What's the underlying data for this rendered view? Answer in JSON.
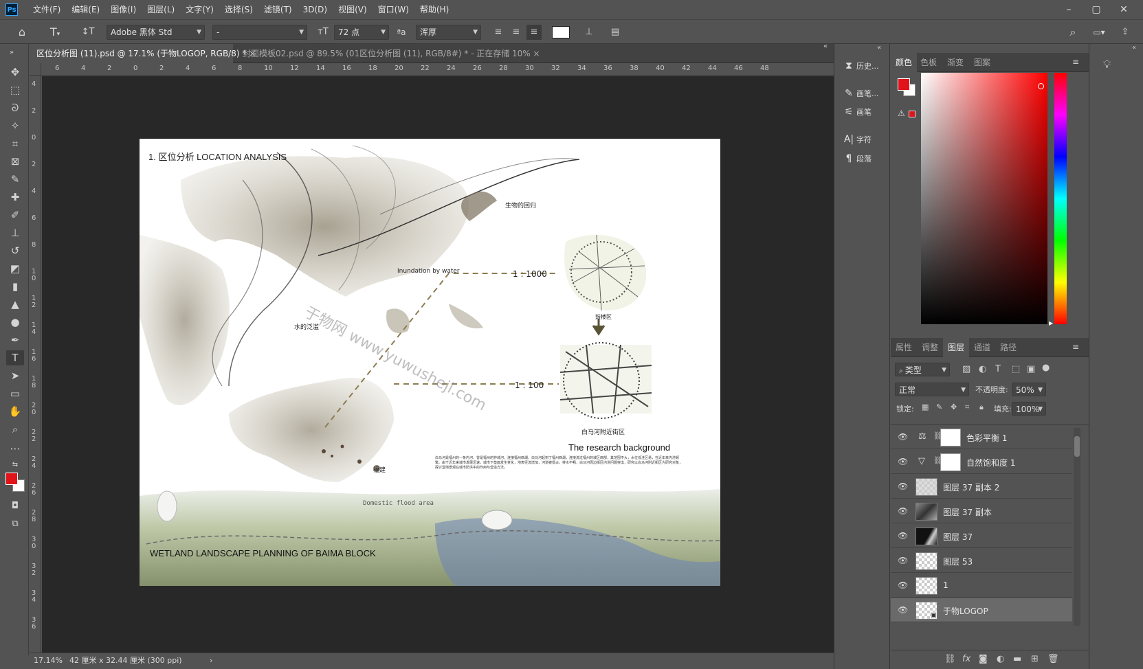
{
  "menubar": {
    "logo": "Ps",
    "items": [
      "文件(F)",
      "编辑(E)",
      "图像(I)",
      "图层(L)",
      "文字(Y)",
      "选择(S)",
      "滤镜(T)",
      "3D(D)",
      "视图(V)",
      "窗口(W)",
      "帮助(H)"
    ]
  },
  "options": {
    "font_family": "Adobe 黑体 Std",
    "font_style": "-",
    "font_size": "72 点",
    "aa_label": "ªa",
    "antialias": "浑厚"
  },
  "tabs": [
    {
      "label": "区位分析图 (11).psd @ 17.1% (于物LOGOP, RGB/8) *",
      "close": "×"
    },
    {
      "label": "封面模板02.psd @ 89.5% (01区位分析图 (11), RGB/8#) * - 正在存储 10%",
      "close": "×"
    }
  ],
  "ruler_top": [
    "6",
    "4",
    "2",
    "0",
    "2",
    "4",
    "6",
    "8",
    "10",
    "12",
    "14",
    "16",
    "18",
    "20",
    "22",
    "24",
    "26",
    "28",
    "30",
    "32",
    "34",
    "36",
    "38",
    "40",
    "42",
    "44",
    "46",
    "48"
  ],
  "ruler_left": [
    "4",
    "2",
    "0",
    "2",
    "4",
    "6",
    "8",
    "1 0",
    "1 2",
    "1 4",
    "1 6",
    "1 8",
    "2 0",
    "2 2",
    "2 4",
    "2 6",
    "2 8",
    "3 0",
    "3 2",
    "3 4",
    "3 6"
  ],
  "artwork": {
    "title": "1. 区位分析  LOCATION ANALYSIS",
    "return_label": "生物的回归",
    "inundation": "Inundation by water",
    "water_spread": "水的泛滥",
    "scale_1000": "1 : 1000",
    "scale_100": "1 : 100",
    "district": "鼓楼区",
    "street": "白马河附近街区",
    "fujian": "福建",
    "flood_area": "Domestic flood area",
    "research_title": "The research background",
    "research_body": "白马河是福州的一条内河，曾是福州的护城河，连接福州西湖、白马河起到了福州西湖，连接流过福州的城区西部，其范围不大，水位低洼区易，在近年来内涝频繁。由于近年来城市发展迅速，城市下垫面发生变化，地表径流增加，河道被侵占，排水不畅，白马河周边街区内涝问题突出，研究以白马河附近街区为研究对象，探讨湿地景观在城市防洪中的作用与营造方法。",
    "footer": "WETLAND LANDSCAPE PLANNING OF BAIMA BLOCK",
    "watermark": "于物网 www.yuwusheji.com"
  },
  "status": {
    "zoom": "17.14%",
    "size": "42 厘米 x 32.44 厘米 (300 ppi)",
    "arrow": "›"
  },
  "panel_strip": [
    {
      "icon": "history-icon",
      "label": "历史..."
    },
    {
      "icon": "brush-settings-icon",
      "label": "画笔..."
    },
    {
      "icon": "brush-icon",
      "label": "画笔"
    },
    {
      "icon": "character-icon",
      "label": "字符"
    },
    {
      "icon": "paragraph-icon",
      "label": "段落"
    }
  ],
  "color_panel": {
    "tabs": [
      "颜色",
      "色板",
      "渐变",
      "图案"
    ],
    "foreground": "#e0141a",
    "background": "#ffffff"
  },
  "layers_panel": {
    "tabs": [
      "属性",
      "调整",
      "图层",
      "通道",
      "路径"
    ],
    "filter": "类型",
    "blend_mode": "正常",
    "opacity_label": "不透明度:",
    "opacity": "50%",
    "lock_label": "锁定:",
    "fill_label": "填充:",
    "fill": "100%",
    "layers": [
      {
        "name": "色彩平衡 1",
        "type": "adjustment",
        "icon": "balance-icon"
      },
      {
        "name": "自然饱和度 1",
        "type": "adjustment",
        "icon": "vibrance-icon"
      },
      {
        "name": "图层 37 副本 2",
        "type": "image"
      },
      {
        "name": "图层 37 副本",
        "type": "image"
      },
      {
        "name": "图层 37",
        "type": "mask"
      },
      {
        "name": "图层 53",
        "type": "empty"
      },
      {
        "name": "1",
        "type": "empty"
      },
      {
        "name": "于物LOGOP",
        "type": "smart",
        "selected": true
      }
    ]
  }
}
